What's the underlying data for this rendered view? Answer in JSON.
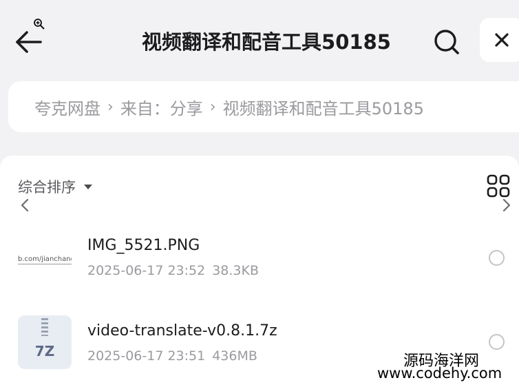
{
  "header": {
    "title": "视频翻译和配音工具50185"
  },
  "breadcrumb": {
    "items": [
      "夸克网盘",
      "来自：分享",
      "视频翻译和配音工具50185"
    ],
    "separator": "›"
  },
  "toolbar": {
    "sort_label": "综合排序"
  },
  "files": [
    {
      "name": "IMG_5521.PNG",
      "date": "2025-06-17 23:52",
      "size": "38.3KB",
      "thumb_text": "b.com/jianchang"
    },
    {
      "name": "video-translate-v0.8.1.7z",
      "date": "2025-06-17 23:51",
      "size": "436MB",
      "thumb_text": "7Z"
    }
  ],
  "watermark": {
    "line1": "源码海洋网",
    "line2": "www.codehy.com"
  },
  "icons": [
    "zoom-in-icon",
    "back-arrow-icon",
    "search-icon",
    "close-icon",
    "sort-caret-icon",
    "grid-view-icon",
    "chevron-left-icon",
    "chevron-right-icon",
    "zip-file-icon"
  ],
  "colors": {
    "background": "#f2f2f4",
    "card": "#ffffff",
    "text_primary": "#1c1c1e",
    "text_secondary": "#9a9a9f"
  }
}
